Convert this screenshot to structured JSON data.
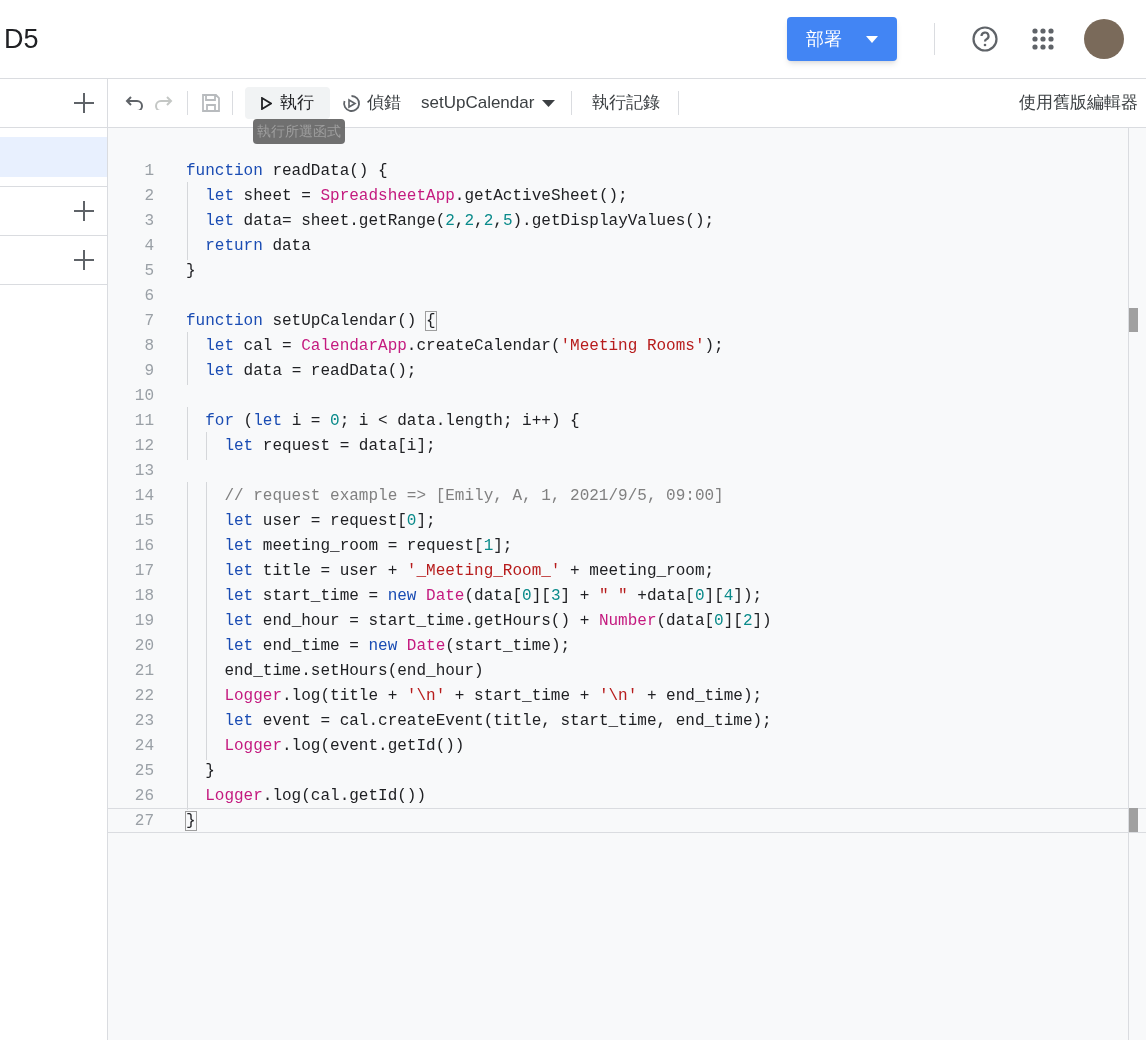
{
  "header": {
    "title": "D5",
    "deploy_button": "部署"
  },
  "sidebar": {
    "rows": [
      {
        "kind": "header",
        "selected": false
      },
      {
        "kind": "item",
        "selected": true
      },
      {
        "kind": "header",
        "selected": false
      },
      {
        "kind": "header",
        "selected": false
      }
    ]
  },
  "toolbar": {
    "undo": {
      "disabled": false
    },
    "redo": {
      "disabled": true
    },
    "save": {
      "disabled": true
    },
    "run_button": "執行",
    "run_tooltip": "執行所選函式",
    "debug_button": "偵錯",
    "function_select": "setUpCalendar",
    "log_button": "執行記錄",
    "legacy_button": "使用舊版編輯器"
  },
  "editor": {
    "lines": [
      {
        "number": "1",
        "current": false,
        "tokens": [
          {
            "kind": "kw",
            "text": "function"
          },
          {
            "kind": "p",
            "text": " readData() {"
          }
        ]
      },
      {
        "number": "2",
        "current": false,
        "tokens": [
          {
            "kind": "kw",
            "text": "  let"
          },
          {
            "kind": "p",
            "text": " sheet = "
          },
          {
            "kind": "cls",
            "text": "SpreadsheetApp"
          },
          {
            "kind": "p",
            "text": ".getActiveSheet();"
          }
        ]
      },
      {
        "number": "3",
        "current": false,
        "tokens": [
          {
            "kind": "kw",
            "text": "  let"
          },
          {
            "kind": "p",
            "text": " data= sheet.getRange("
          },
          {
            "kind": "num",
            "text": "2"
          },
          {
            "kind": "p",
            "text": ","
          },
          {
            "kind": "num",
            "text": "2"
          },
          {
            "kind": "p",
            "text": ","
          },
          {
            "kind": "num",
            "text": "2"
          },
          {
            "kind": "p",
            "text": ","
          },
          {
            "kind": "num",
            "text": "5"
          },
          {
            "kind": "p",
            "text": ").getDisplayValues();"
          }
        ]
      },
      {
        "number": "4",
        "current": false,
        "tokens": [
          {
            "kind": "kw",
            "text": "  return"
          },
          {
            "kind": "p",
            "text": " data"
          }
        ]
      },
      {
        "number": "5",
        "current": false,
        "tokens": [
          {
            "kind": "p",
            "text": "}"
          }
        ]
      },
      {
        "number": "6",
        "current": false
      },
      {
        "number": "7",
        "current": false,
        "tokens": [
          {
            "kind": "kw",
            "text": "function"
          },
          {
            "kind": "p",
            "text": " setUpCalendar() "
          },
          {
            "kind": "match",
            "text": "{"
          }
        ]
      },
      {
        "number": "8",
        "current": false,
        "tokens": [
          {
            "kind": "kw",
            "text": "  let"
          },
          {
            "kind": "p",
            "text": " cal = "
          },
          {
            "kind": "cls",
            "text": "CalendarApp"
          },
          {
            "kind": "p",
            "text": ".createCalendar("
          },
          {
            "kind": "str",
            "text": "'Meeting Rooms'"
          },
          {
            "kind": "p",
            "text": ");"
          }
        ]
      },
      {
        "number": "9",
        "current": false,
        "tokens": [
          {
            "kind": "kw",
            "text": "  let"
          },
          {
            "kind": "p",
            "text": " data = readData();"
          }
        ]
      },
      {
        "number": "10",
        "current": false
      },
      {
        "number": "11",
        "current": false,
        "tokens": [
          {
            "kind": "kw",
            "text": "  for"
          },
          {
            "kind": "p",
            "text": " ("
          },
          {
            "kind": "kw",
            "text": "let"
          },
          {
            "kind": "p",
            "text": " i = "
          },
          {
            "kind": "num",
            "text": "0"
          },
          {
            "kind": "p",
            "text": "; i < data.length; i++) {"
          }
        ]
      },
      {
        "number": "12",
        "current": false,
        "tokens": [
          {
            "kind": "kw",
            "text": "    let"
          },
          {
            "kind": "p",
            "text": " request = data[i];"
          }
        ]
      },
      {
        "number": "13",
        "current": false
      },
      {
        "number": "14",
        "current": false,
        "tokens": [
          {
            "kind": "cmt",
            "text": "    // request example => [Emily, A, 1, 2021/9/5, 09:00]"
          }
        ]
      },
      {
        "number": "15",
        "current": false,
        "tokens": [
          {
            "kind": "kw",
            "text": "    let"
          },
          {
            "kind": "p",
            "text": " user = request["
          },
          {
            "kind": "num",
            "text": "0"
          },
          {
            "kind": "p",
            "text": "];"
          }
        ]
      },
      {
        "number": "16",
        "current": false,
        "tokens": [
          {
            "kind": "kw",
            "text": "    let"
          },
          {
            "kind": "p",
            "text": " meeting_room = request["
          },
          {
            "kind": "num",
            "text": "1"
          },
          {
            "kind": "p",
            "text": "];"
          }
        ]
      },
      {
        "number": "17",
        "current": false,
        "tokens": [
          {
            "kind": "kw",
            "text": "    let"
          },
          {
            "kind": "p",
            "text": " title = user + "
          },
          {
            "kind": "str",
            "text": "'_Meeting_Room_'"
          },
          {
            "kind": "p",
            "text": " + meeting_room;"
          }
        ]
      },
      {
        "number": "18",
        "current": false,
        "tokens": [
          {
            "kind": "kw",
            "text": "    let"
          },
          {
            "kind": "p",
            "text": " start_time = "
          },
          {
            "kind": "kw",
            "text": "new"
          },
          {
            "kind": "cls",
            "text": " Date"
          },
          {
            "kind": "p",
            "text": "(data["
          },
          {
            "kind": "num",
            "text": "0"
          },
          {
            "kind": "p",
            "text": "]["
          },
          {
            "kind": "num",
            "text": "3"
          },
          {
            "kind": "p",
            "text": "] + "
          },
          {
            "kind": "str",
            "text": "\" \""
          },
          {
            "kind": "p",
            "text": " +data["
          },
          {
            "kind": "num",
            "text": "0"
          },
          {
            "kind": "p",
            "text": "]["
          },
          {
            "kind": "num",
            "text": "4"
          },
          {
            "kind": "p",
            "text": "]);"
          }
        ]
      },
      {
        "number": "19",
        "current": false,
        "tokens": [
          {
            "kind": "kw",
            "text": "    let"
          },
          {
            "kind": "p",
            "text": " end_hour = start_time.getHours() + "
          },
          {
            "kind": "cls",
            "text": "Number"
          },
          {
            "kind": "p",
            "text": "(data["
          },
          {
            "kind": "num",
            "text": "0"
          },
          {
            "kind": "p",
            "text": "]["
          },
          {
            "kind": "num",
            "text": "2"
          },
          {
            "kind": "p",
            "text": "])"
          }
        ]
      },
      {
        "number": "20",
        "current": false,
        "tokens": [
          {
            "kind": "kw",
            "text": "    let"
          },
          {
            "kind": "p",
            "text": " end_time = "
          },
          {
            "kind": "kw",
            "text": "new"
          },
          {
            "kind": "cls",
            "text": " Date"
          },
          {
            "kind": "p",
            "text": "(start_time);"
          }
        ]
      },
      {
        "number": "21",
        "current": false,
        "tokens": [
          {
            "kind": "p",
            "text": "    end_time.setHours(end_hour)"
          }
        ]
      },
      {
        "number": "22",
        "current": false,
        "tokens": [
          {
            "kind": "cls",
            "text": "    Logger"
          },
          {
            "kind": "p",
            "text": ".log(title + "
          },
          {
            "kind": "str",
            "text": "'\\n'"
          },
          {
            "kind": "p",
            "text": " + start_time + "
          },
          {
            "kind": "str",
            "text": "'\\n'"
          },
          {
            "kind": "p",
            "text": " + end_time);"
          }
        ]
      },
      {
        "number": "23",
        "current": false,
        "tokens": [
          {
            "kind": "kw",
            "text": "    let"
          },
          {
            "kind": "p",
            "text": " event = cal.createEvent(title, start_time, end_time);"
          }
        ]
      },
      {
        "number": "24",
        "current": false,
        "tokens": [
          {
            "kind": "cls",
            "text": "    Logger"
          },
          {
            "kind": "p",
            "text": ".log(event.getId())"
          }
        ]
      },
      {
        "number": "25",
        "current": false,
        "tokens": [
          {
            "kind": "p",
            "text": "  }"
          }
        ]
      },
      {
        "number": "26",
        "current": false,
        "tokens": [
          {
            "kind": "cls",
            "text": "  Logger"
          },
          {
            "kind": "p",
            "text": ".log(cal.getId())"
          }
        ]
      },
      {
        "number": "27",
        "current": true,
        "tokens": [
          {
            "kind": "match",
            "text": "}"
          }
        ]
      }
    ]
  }
}
